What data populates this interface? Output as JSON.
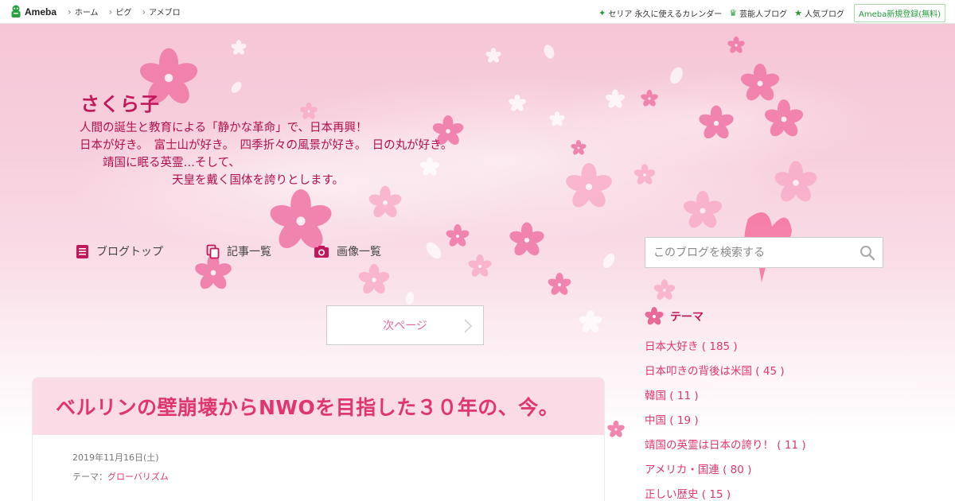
{
  "topbar": {
    "logo_text": "Ameba",
    "nav": [
      "ホーム",
      "ピグ",
      "アメブロ"
    ],
    "right_links": [
      {
        "icon": "sparkle-icon",
        "label": "セリア 永久に使えるカレンダー"
      },
      {
        "icon": "crown-icon",
        "label": "芸能人ブログ"
      },
      {
        "icon": "star-icon",
        "label": "人気ブログ"
      }
    ],
    "register_label": "Ameba新規登録(無料)"
  },
  "blog": {
    "title": "さくら子",
    "description": "人間の誕生と教育による「静かな革命」で、日本再興！\n日本が好き。　富士山が好き。　四季折々の風景が好き。　日の丸が好き。\n　　靖国に眠る英霊…そして、\n　　　　　　　　天皇を戴く国体を誇りとします。"
  },
  "blog_nav": {
    "top": "ブログトップ",
    "articles": "記事一覧",
    "images": "画像一覧"
  },
  "search": {
    "placeholder": "このブログを検索する"
  },
  "pager": {
    "next_label": "次ページ"
  },
  "article": {
    "title": "ベルリンの壁崩壊からNWOを目指した３０年の、今。",
    "date": "2019年11月16日(土)",
    "theme_label": "テーマ：",
    "theme": "グローバリズム"
  },
  "theme_section": {
    "heading": "テーマ",
    "items": [
      "日本大好き ( 185 )",
      "日本叩きの背後は米国 ( 45 )",
      "韓国 ( 11 )",
      "中国 ( 19 )",
      "靖国の英霊は日本の誇り！ ( 11 )",
      "アメリカ・国連 ( 80 )",
      "正しい歴史 ( 15 )"
    ]
  },
  "colors": {
    "accent": "#e0366f",
    "title": "#c2185b",
    "ameba_green": "#239a3b",
    "card_head": "#fbdbe5"
  }
}
